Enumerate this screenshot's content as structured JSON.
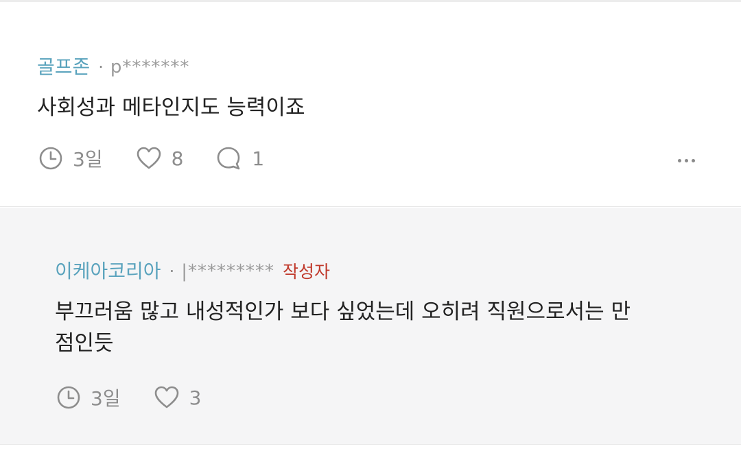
{
  "comments": [
    {
      "nickname": "골프존",
      "separator": "·",
      "user_id": "p*******",
      "body": "사회성과 메타인지도 능력이죠",
      "time": "3일",
      "likes": "8",
      "replies": "1",
      "icons": {
        "time": "clock-icon",
        "like": "heart-icon",
        "reply": "speech-bubble-icon",
        "more": "more-dots-icon"
      }
    },
    {
      "nickname": "이케아코리아",
      "separator": "·",
      "user_id": "|*********",
      "author_badge": "작성자",
      "body": "부끄러움 많고 내성적인가 보다 싶었는데 오히려 직원으로서는 만\n점인듯",
      "time": "3일",
      "likes": "3",
      "icons": {
        "time": "clock-icon",
        "like": "heart-icon"
      }
    }
  ],
  "colors": {
    "nickname": "#5aa3bd",
    "author_badge": "#c0392b",
    "reply_background": "#f5f5f6",
    "meta_text": "#8d8d8d",
    "body_text": "#222222"
  }
}
